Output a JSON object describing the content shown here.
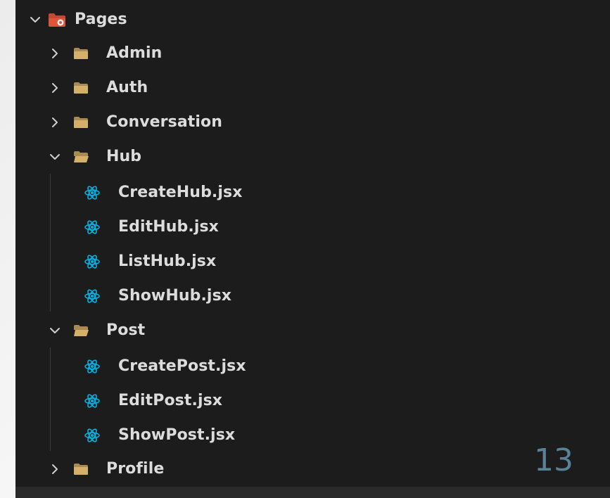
{
  "tree": {
    "root": {
      "label": "Pages",
      "expanded": true,
      "icon": "pages-folder-icon"
    },
    "items": [
      {
        "label": "Admin",
        "expanded": false,
        "type": "folder"
      },
      {
        "label": "Auth",
        "expanded": false,
        "type": "folder"
      },
      {
        "label": "Conversation",
        "expanded": false,
        "type": "folder"
      },
      {
        "label": "Hub",
        "expanded": true,
        "type": "folder",
        "children": [
          "CreateHub.jsx",
          "EditHub.jsx",
          "ListHub.jsx",
          "ShowHub.jsx"
        ]
      },
      {
        "label": "Post",
        "expanded": true,
        "type": "folder",
        "children": [
          "CreatePost.jsx",
          "EditPost.jsx",
          "ShowPost.jsx"
        ]
      },
      {
        "label": "Profile",
        "expanded": false,
        "type": "folder"
      }
    ]
  },
  "slide": {
    "page_number": "13"
  },
  "colors": {
    "panel_bg": "#1c1c1c",
    "text": "#dcdcdc",
    "folder": "#c9a867",
    "react": "#00b4e6",
    "page_number": "#5a8296"
  }
}
